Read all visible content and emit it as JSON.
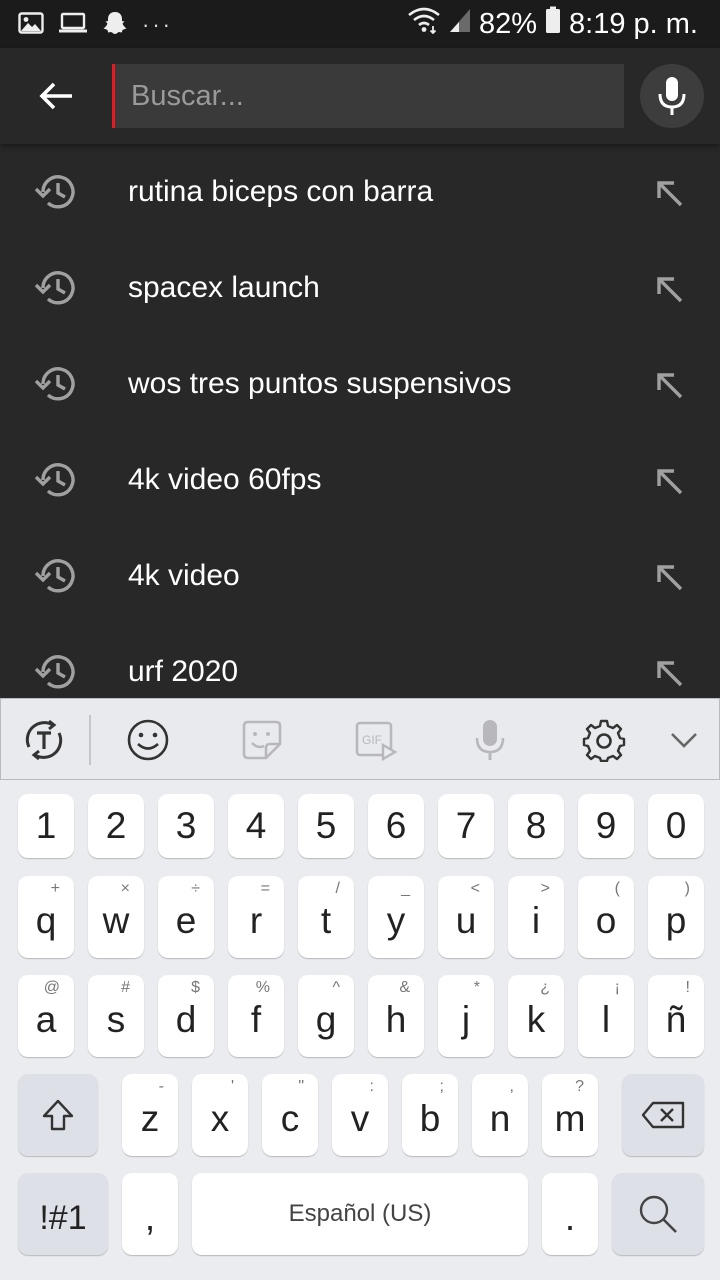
{
  "status_bar": {
    "battery": "82%",
    "time": "8:19 p. m.",
    "left_icons": [
      "image-icon",
      "laptop-icon",
      "snapchat-ghost-icon",
      "more-dots-icon"
    ],
    "right_icons": [
      "wifi-icon",
      "signal-icon",
      "battery-icon"
    ]
  },
  "search": {
    "placeholder": "Buscar...",
    "value": "",
    "accent_color": "#e31b23"
  },
  "suggestions": [
    {
      "text": "rutina biceps con barra"
    },
    {
      "text": "spacex launch"
    },
    {
      "text": "wos tres puntos suspensivos"
    },
    {
      "text": "4k video 60fps"
    },
    {
      "text": "4k video"
    },
    {
      "text": "urf 2020"
    }
  ],
  "keyboard": {
    "toolbar": [
      "text-toggle-icon",
      "emoji-icon",
      "sticker-icon",
      "gif-icon",
      "voice-input-icon",
      "settings-gear-icon",
      "collapse-chevron-icon"
    ],
    "gif_label": "GIF",
    "number_row": [
      "1",
      "2",
      "3",
      "4",
      "5",
      "6",
      "7",
      "8",
      "9",
      "0"
    ],
    "row1": [
      {
        "key": "q",
        "hint": "+"
      },
      {
        "key": "w",
        "hint": "×"
      },
      {
        "key": "e",
        "hint": "÷"
      },
      {
        "key": "r",
        "hint": "="
      },
      {
        "key": "t",
        "hint": "/"
      },
      {
        "key": "y",
        "hint": "_"
      },
      {
        "key": "u",
        "hint": "<"
      },
      {
        "key": "i",
        "hint": ">"
      },
      {
        "key": "o",
        "hint": "("
      },
      {
        "key": "p",
        "hint": ")"
      }
    ],
    "row2": [
      {
        "key": "a",
        "hint": "@"
      },
      {
        "key": "s",
        "hint": "#"
      },
      {
        "key": "d",
        "hint": "$"
      },
      {
        "key": "f",
        "hint": "%"
      },
      {
        "key": "g",
        "hint": "^"
      },
      {
        "key": "h",
        "hint": "&"
      },
      {
        "key": "j",
        "hint": "*"
      },
      {
        "key": "k",
        "hint": "¿"
      },
      {
        "key": "l",
        "hint": "¡"
      },
      {
        "key": "ñ",
        "hint": "!"
      }
    ],
    "row3": [
      {
        "key": "z",
        "hint": "-"
      },
      {
        "key": "x",
        "hint": "'"
      },
      {
        "key": "c",
        "hint": "\""
      },
      {
        "key": "v",
        "hint": ":"
      },
      {
        "key": "b",
        "hint": ";"
      },
      {
        "key": "n",
        "hint": ","
      },
      {
        "key": "m",
        "hint": "?"
      }
    ],
    "symbols_label": "!#1",
    "comma_label": ",",
    "space_label": "Español (US)",
    "period_label": ".",
    "colors": {
      "background": "#ebecf0",
      "key": "#ffffff",
      "function_key": "#dde0e6"
    }
  },
  "theme": {
    "background": "#282828",
    "status_bar": "#1b1b1b",
    "input_background": "#3a3a3a"
  }
}
